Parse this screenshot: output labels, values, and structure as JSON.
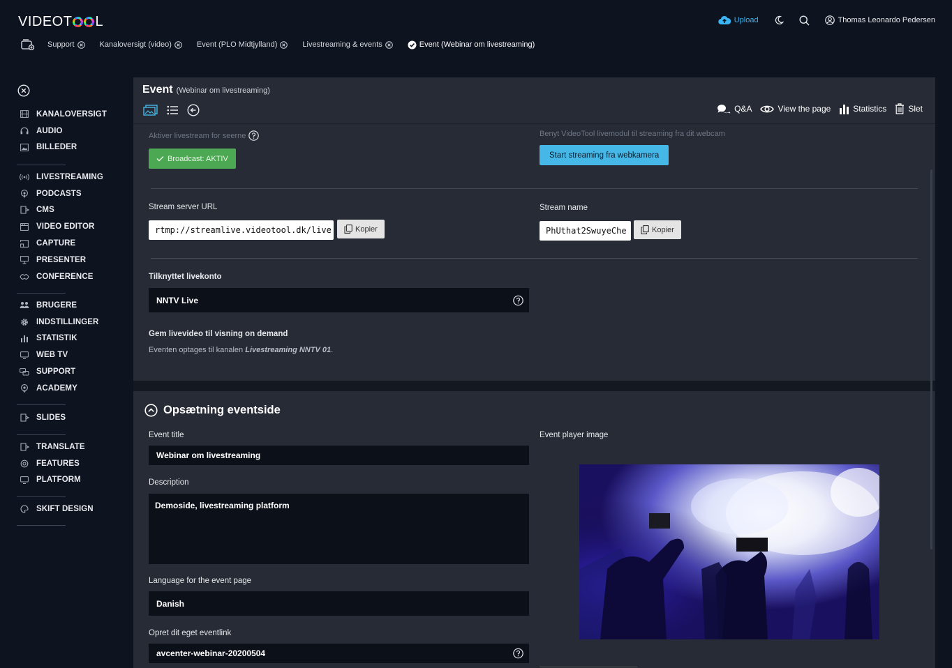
{
  "app": {
    "logo": {
      "prefix": "VIDEOT",
      "suffix": "L"
    },
    "upload_label": "Upload",
    "user_name": "Thomas Leonardo Pedersen"
  },
  "tabs": [
    {
      "label": "Support",
      "active": false
    },
    {
      "label": "Kanaloversigt (video)",
      "active": false
    },
    {
      "label": "Event (PLO Midtjylland)",
      "active": false
    },
    {
      "label": "Livestreaming & events",
      "active": false
    },
    {
      "label": "Event (Webinar om livestreaming)",
      "active": true
    }
  ],
  "sidebar": {
    "groups": [
      [
        {
          "label": "KANALOVERSIGT",
          "icon": "film-icon"
        },
        {
          "label": "AUDIO",
          "icon": "headphones-icon"
        },
        {
          "label": "BILLEDER",
          "icon": "image-icon"
        }
      ],
      [
        {
          "label": "LIVESTREAMING",
          "icon": "broadcast-icon"
        },
        {
          "label": "PODCASTS",
          "icon": "podcast-icon"
        },
        {
          "label": "CMS",
          "icon": "cms-icon"
        },
        {
          "label": "VIDEO EDITOR",
          "icon": "editor-icon"
        },
        {
          "label": "CAPTURE",
          "icon": "capture-icon"
        },
        {
          "label": "PRESENTER",
          "icon": "presenter-icon"
        },
        {
          "label": "CONFERENCE",
          "icon": "conference-icon"
        }
      ],
      [
        {
          "label": "BRUGERE",
          "icon": "users-icon"
        },
        {
          "label": "INDSTILLINGER",
          "icon": "gear-icon"
        },
        {
          "label": "STATISTIK",
          "icon": "bar-chart-icon"
        },
        {
          "label": "WEB TV",
          "icon": "monitor-icon"
        },
        {
          "label": "SUPPORT",
          "icon": "support-icon"
        },
        {
          "label": "ACADEMY",
          "icon": "academy-icon"
        }
      ],
      [
        {
          "label": "SLIDES",
          "icon": "slides-icon"
        }
      ],
      [
        {
          "label": "TRANSLATE",
          "icon": "translate-icon"
        },
        {
          "label": "FEATURES",
          "icon": "features-icon"
        },
        {
          "label": "PLATFORM",
          "icon": "platform-icon"
        }
      ],
      [
        {
          "label": "SKIFT DESIGN",
          "icon": "palette-icon"
        }
      ]
    ]
  },
  "header": {
    "title": "Event",
    "subtitle": "(Webinar om livestreaming)",
    "actions": {
      "qa": "Q&A",
      "view": "View the page",
      "statistics": "Statistics",
      "delete": "Slet"
    }
  },
  "livestream": {
    "activate_label": "Aktiver livestream for seerne",
    "broadcast_button": "Broadcast: AKTIV",
    "webcam_hint": "Benyt VideoTool livemodul til streaming fra dit webcam",
    "webcam_button": "Start streaming fra webkamera",
    "server_url_label": "Stream server URL",
    "server_url_value": "rtmp://streamlive.videotool.dk/live",
    "stream_name_label": "Stream name",
    "stream_name_value": "PhUthat2SwuyeChe",
    "copy_label": "Kopier",
    "account_label": "Tilknyttet livekonto",
    "account_value": "NNTV Live",
    "ondemand_label": "Gem livevideo til visning on demand",
    "ondemand_text_prefix": "Eventen optages til kanalen ",
    "ondemand_channel": "Livestreaming NNTV 01",
    "ondemand_text_suffix": "."
  },
  "eventpage": {
    "section_title": "Opsætning eventside",
    "title_label": "Event title",
    "title_value": "Webinar om livestreaming",
    "description_label": "Description",
    "description_value": "Demoside, livestreaming platform",
    "language_label": "Language for the event page",
    "language_value": "Danish",
    "eventlink_label": "Opret dit eget eventlink",
    "eventlink_value": "avcenter-webinar-20200504",
    "player_image_label": "Event player image"
  },
  "colors": {
    "accent_blue": "#45b8e8",
    "active_green": "#4ca852",
    "background": "#0e1320",
    "panel": "#262b35",
    "input": "#0c1019"
  }
}
